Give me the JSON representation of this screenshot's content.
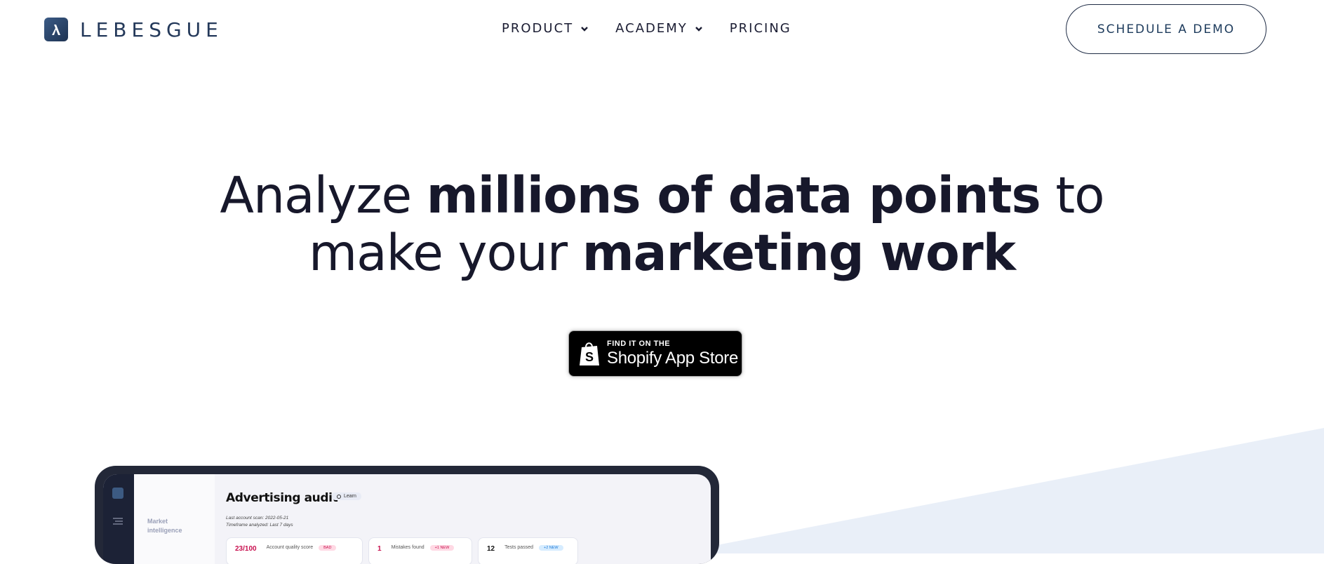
{
  "brand": {
    "name": "LEBESGUE",
    "logo_icon": "lambda-logo-icon"
  },
  "nav": {
    "items": [
      {
        "label": "PRODUCT",
        "has_dropdown": true
      },
      {
        "label": "ACADEMY",
        "has_dropdown": true
      },
      {
        "label": "PRICING",
        "has_dropdown": false
      }
    ]
  },
  "cta": {
    "demo_label": "SCHEDULE A DEMO"
  },
  "hero": {
    "line1_part1": "Analyze ",
    "line1_bold": "millions of data points",
    "line1_part2": " to",
    "line2_part1": "make your ",
    "line2_bold": "marketing work"
  },
  "shopify_badge": {
    "small_text": "FIND IT ON THE",
    "big_text": "Shopify App Store",
    "icon": "shopify-bag-icon"
  },
  "app_preview": {
    "sidebar_label_line1": "Market",
    "sidebar_label_line2": "intelligence",
    "title": "Advertising audit",
    "learn_label": "Learn",
    "meta_line1": "Last account scan: 2022-05-21",
    "meta_line2": "Timeframe analyzed: Last 7 days",
    "cards": [
      {
        "value": "23/100",
        "label": "Account quality score",
        "pill": "BAD",
        "value_color": "#c8104f",
        "pill_bg": "#ffd9e4",
        "pill_fg": "#c8104f"
      },
      {
        "value": "1",
        "label": "Mistakes found",
        "pill": "+1 NEW",
        "value_color": "#c8104f",
        "pill_bg": "#ffd9e4",
        "pill_fg": "#c8104f"
      },
      {
        "value": "12",
        "label": "Tests passed",
        "pill": "+2 NEW",
        "value_color": "#111111",
        "pill_bg": "#d6ecff",
        "pill_fg": "#1d7ad8"
      }
    ]
  },
  "colors": {
    "brand_navy": "#24395a",
    "text_dark": "#17182b",
    "wedge": "#e8eef8"
  }
}
